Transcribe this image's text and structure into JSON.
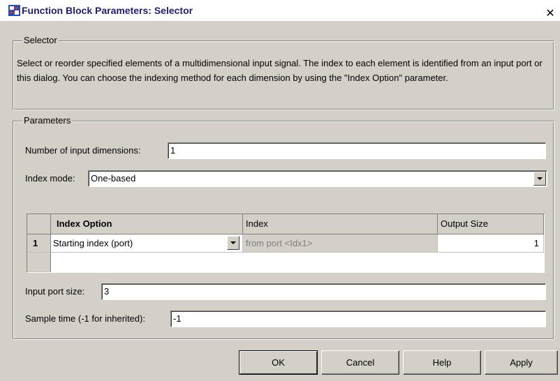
{
  "window": {
    "title": "Function Block Parameters: Selector",
    "close_glyph": "✕"
  },
  "selector_group": {
    "legend": "Selector",
    "description": "Select or reorder specified elements of a multidimensional input signal. The index to each element is identified from an input port or this dialog. You can choose the indexing method for each dimension by using the \"Index Option\" parameter."
  },
  "parameters": {
    "legend": "Parameters",
    "num_dims_label": "Number of input dimensions:",
    "num_dims_value": "1",
    "index_mode_label": "Index mode:",
    "index_mode_value": "One-based",
    "table": {
      "headers": [
        "Index Option",
        "Index",
        "Output Size"
      ],
      "rows": [
        {
          "num": "1",
          "option": "Starting index (port)",
          "index": "from port <Idx1>",
          "output_size": "1"
        }
      ]
    },
    "input_port_label": "Input port size:",
    "input_port_value": "3",
    "sample_time_label": "Sample time (-1 for inherited):",
    "sample_time_value": "-1"
  },
  "buttons": {
    "ok": "OK",
    "cancel": "Cancel",
    "help": "Help",
    "apply": "Apply"
  },
  "icons": {
    "app": "simulink-block-icon",
    "dropdown": "chevron-down-icon"
  }
}
